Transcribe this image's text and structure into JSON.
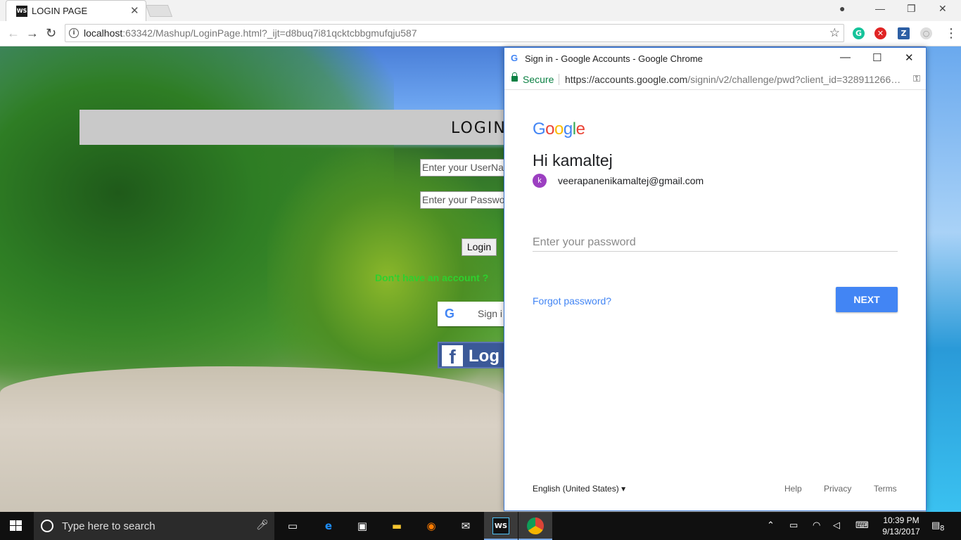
{
  "browser": {
    "tab_title": "LOGIN PAGE",
    "tab_favicon": "WS",
    "url_host": "localhost",
    "url_rest": ":63342/Mashup/LoginPage.html?_ijt=d8buq7i81qcktcbbgmufqju587",
    "extensions": [
      {
        "name": "grammarly-icon",
        "glyph": "G",
        "color": "#15c39a"
      },
      {
        "name": "adblock-icon",
        "glyph": "✕",
        "color": "#e02424"
      },
      {
        "name": "zotero-icon",
        "glyph": "Z",
        "color": "#2d5fa4"
      }
    ]
  },
  "page": {
    "banner": "LOGIN D",
    "username_placeholder": "Enter your UserNar",
    "password_placeholder": "Enter your Passwo",
    "login_button": "Login",
    "no_account": "Don't have an account ?",
    "google_btn": "Sign i",
    "fb_btn": "Log"
  },
  "popup": {
    "title": "Sign in - Google Accounts - Google Chrome",
    "secure_label": "Secure",
    "url_host": "https://accounts.google.com",
    "url_rest": "/signin/v2/challenge/pwd?client_id=328911266…",
    "greeting": "Hi kamaltej",
    "avatar_letter": "k",
    "email": "veerapanenikamaltej@gmail.com",
    "password_placeholder": "Enter your password",
    "forgot_link": "Forgot password?",
    "next_button": "NEXT",
    "language": "English (United States)",
    "footer": {
      "help": "Help",
      "privacy": "Privacy",
      "terms": "Terms"
    },
    "colors": {
      "accent": "#4285f4",
      "secure": "#0b8043"
    }
  },
  "taskbar": {
    "search_placeholder": "Type here to search",
    "time": "10:39 PM",
    "date": "9/13/2017",
    "notification_count": "8"
  }
}
